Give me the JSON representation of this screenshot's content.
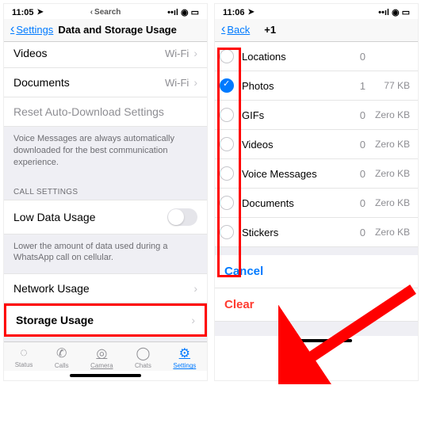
{
  "left": {
    "status": {
      "time": "11:05",
      "search": "Search"
    },
    "nav": {
      "back": "Settings",
      "title": "Data and Storage Usage"
    },
    "rows": {
      "videos": {
        "label": "Videos",
        "value": "Wi-Fi"
      },
      "documents": {
        "label": "Documents",
        "value": "Wi-Fi"
      },
      "reset": {
        "label": "Reset Auto-Download Settings"
      }
    },
    "voice_note": "Voice Messages are always automatically downloaded for the best communication experience.",
    "call_header": "CALL SETTINGS",
    "low_data": {
      "label": "Low Data Usage"
    },
    "low_data_note": "Lower the amount of data used during a WhatsApp call on cellular.",
    "network": {
      "label": "Network Usage"
    },
    "storage": {
      "label": "Storage Usage"
    },
    "tabs": {
      "status": "Status",
      "calls": "Calls",
      "camera": "Camera",
      "chats": "Chats",
      "settings": "Settings"
    }
  },
  "right": {
    "status": {
      "time": "11:06"
    },
    "nav": {
      "back": "Back",
      "title": "+1"
    },
    "items": [
      {
        "label": "Locations",
        "count": "0",
        "size": "",
        "checked": false
      },
      {
        "label": "Photos",
        "count": "1",
        "size": "77 KB",
        "checked": true
      },
      {
        "label": "GIFs",
        "count": "0",
        "size": "Zero KB",
        "checked": false
      },
      {
        "label": "Videos",
        "count": "0",
        "size": "Zero KB",
        "checked": false
      },
      {
        "label": "Voice Messages",
        "count": "0",
        "size": "Zero KB",
        "checked": false
      },
      {
        "label": "Documents",
        "count": "0",
        "size": "Zero KB",
        "checked": false
      },
      {
        "label": "Stickers",
        "count": "0",
        "size": "Zero KB",
        "checked": false
      }
    ],
    "cancel": "Cancel",
    "clear": "Clear"
  }
}
